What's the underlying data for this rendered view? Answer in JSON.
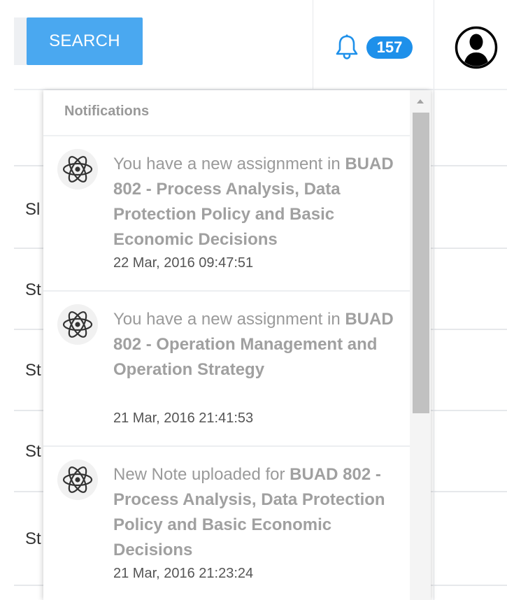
{
  "header": {
    "search_label": "SEARCH",
    "notification_count": "157"
  },
  "table": {
    "cells": [
      "Sl",
      "St",
      "St",
      "St",
      "St"
    ]
  },
  "notifications": {
    "title": "Notifications",
    "items": [
      {
        "prefix": "You have a new assignment in ",
        "course": "BUAD 802 - Process Analysis, Data Protection Policy and Basic Economic Decisions",
        "time": "22 Mar, 2016 09:47:51",
        "icon": "atom-icon"
      },
      {
        "prefix": "You have a new assignment in ",
        "course": "BUAD 802 - Operation Management and Operation Strategy",
        "time": "21 Mar, 2016 21:41:53",
        "icon": "atom-icon"
      },
      {
        "prefix": "New Note uploaded for ",
        "course": "BUAD 802 - Process Analysis, Data Protection Policy and Basic Economic Decisions",
        "time": "21 Mar, 2016 21:23:24",
        "icon": "atom-icon"
      }
    ]
  },
  "colors": {
    "search_button": "#4aa8f0",
    "badge": "#1e90ea",
    "bell": "#1e90ea"
  }
}
